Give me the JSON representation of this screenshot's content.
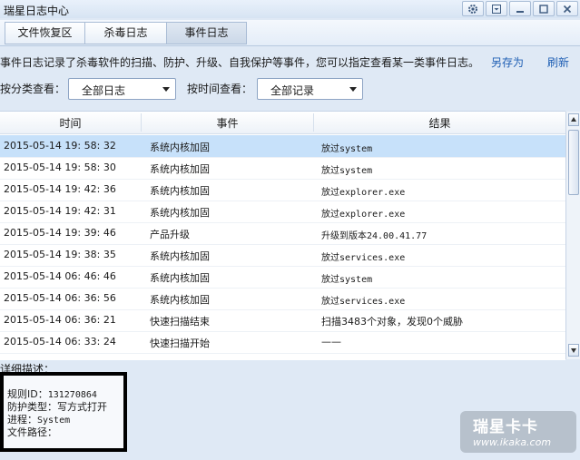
{
  "window": {
    "title": "瑞星日志中心"
  },
  "tabs": [
    {
      "label": "文件恢复区"
    },
    {
      "label": "杀毒日志"
    },
    {
      "label": "事件日志"
    }
  ],
  "description": "事件日志记录了杀毒软件的扫描、防护、升级、自我保护等事件，您可以指定查看某一类事件日志。",
  "actions": {
    "save_as": "另存为",
    "refresh": "刷新"
  },
  "filters": {
    "category_label": "按分类查看：",
    "category_value": "全部日志",
    "time_label": "按时间查看：",
    "time_value": "全部记录"
  },
  "table": {
    "columns": [
      "时间",
      "事件",
      "结果"
    ],
    "rows": [
      {
        "time": "2015-05-14 19: 58: 32",
        "event": "系统内核加固",
        "result": "放过system"
      },
      {
        "time": "2015-05-14 19: 58: 30",
        "event": "系统内核加固",
        "result": "放过system"
      },
      {
        "time": "2015-05-14 19: 42: 36",
        "event": "系统内核加固",
        "result": "放过explorer.exe"
      },
      {
        "time": "2015-05-14 19: 42: 31",
        "event": "系统内核加固",
        "result": "放过explorer.exe"
      },
      {
        "time": "2015-05-14 19: 39: 46",
        "event": "产品升级",
        "result": "升级到版本24.00.41.77"
      },
      {
        "time": "2015-05-14 19: 38: 35",
        "event": "系统内核加固",
        "result": "放过services.exe"
      },
      {
        "time": "2015-05-14 06: 46: 46",
        "event": "系统内核加固",
        "result": "放过system"
      },
      {
        "time": "2015-05-14 06: 36: 56",
        "event": "系统内核加固",
        "result": "放过services.exe"
      },
      {
        "time": "2015-05-14 06: 36: 21",
        "event": "快速扫描结束",
        "result": "扫描3483个对象，发现0个威胁"
      },
      {
        "time": "2015-05-14 06: 33: 24",
        "event": "快速扫描开始",
        "result": "——"
      }
    ]
  },
  "detail": {
    "label": "详细描述：",
    "rule_id_label": "规则ID：",
    "rule_id": "131270864",
    "protect_type_label": "防护类型：",
    "protect_type": "写方式打开",
    "process_label": "进程：",
    "process": "System",
    "file_path_label": "文件路径："
  },
  "watermark": {
    "brand": "瑞星卡卡",
    "url": "www.ikaka.com"
  },
  "colors": {
    "selected_row": "#c7e1fa",
    "link": "#1f5fb4",
    "accent": "#d7e4f3"
  }
}
